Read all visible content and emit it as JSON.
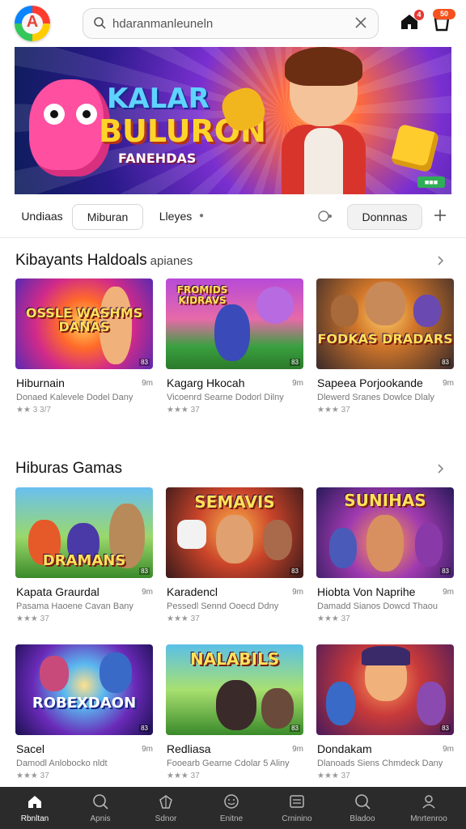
{
  "header": {
    "logo_letter": "A",
    "search_text": "hdaranmanleuneln",
    "cart_badge": "4",
    "notif_badge": "50"
  },
  "banner": {
    "title_line1": "KALAR",
    "title_line2": "BULURON",
    "title_line3": "FANEHDAS",
    "tag": "■■■"
  },
  "tabs": [
    "Undiaas",
    "Miburan",
    "Lleyes",
    "Donnnas"
  ],
  "sections": [
    {
      "title": "Kibayants Haldoals",
      "subtitle": "apianes",
      "cards": [
        {
          "name": "Hiburnain",
          "size": "9m",
          "desc": "Donaed Kalevele Dodel Dany",
          "rating": "★★ 3 3/7",
          "thumb_title": "OSSLE WASHMS DANAS",
          "tag": "83"
        },
        {
          "name": "Kagarg Hkocah",
          "size": "9m",
          "desc": "Vicoenrd Searne Dodorl Dilny",
          "rating": "★★★ 37",
          "thumb_title": "FROMIDS KIDRAVS",
          "tag": "83"
        },
        {
          "name": "Sapeea Porjookande",
          "size": "9m",
          "desc": "Dlewerd Sranes Dowlce Dlaly",
          "rating": "★★★ 37",
          "thumb_title": "FODKAS DRADARS",
          "tag": "83"
        }
      ]
    },
    {
      "title": "Hiburas Gamas",
      "subtitle": "",
      "cards": [
        {
          "name": "Kapata Graurdal",
          "size": "9m",
          "desc": "Pasama Haoene Cavan Bany",
          "rating": "★★★ 37",
          "thumb_title": "DRAMANS",
          "tag": "83"
        },
        {
          "name": "Karadencl",
          "size": "9m",
          "desc": "Pessedl Sennd Ooecd Ddny",
          "rating": "★★★ 37",
          "thumb_title": "SEMAVIS",
          "tag": "83"
        },
        {
          "name": "Hiobta Von Naprihe",
          "size": "9m",
          "desc": "Damadd Sianos Dowcd Thaou",
          "rating": "★★★ 37",
          "thumb_title": "SUNIHAS",
          "tag": "83"
        }
      ]
    },
    {
      "title": "",
      "subtitle": "",
      "cards": [
        {
          "name": "Sacel",
          "size": "9m",
          "desc": "Damodl Anlobocko nldt",
          "rating": "★★★ 37",
          "thumb_title": "ROBEXDAON",
          "tag": "83"
        },
        {
          "name": "Redliasa",
          "size": "9m",
          "desc": "Fooearb Gearne Cdolar 5 Aliny",
          "rating": "★★★ 37",
          "thumb_title": "NALABILS",
          "tag": "83"
        },
        {
          "name": "Dondakam",
          "size": "9m",
          "desc": "Dlanoads Siens Chmdeck Dany",
          "rating": "★★★ 37",
          "thumb_title": "",
          "tag": "83"
        }
      ]
    }
  ],
  "bottom_nav": [
    {
      "label": "Rbnltan",
      "icon": "home-icon"
    },
    {
      "label": "Apnis",
      "icon": "search-icon"
    },
    {
      "label": "Sdnor",
      "icon": "gift-icon"
    },
    {
      "label": "Enitne",
      "icon": "smile-icon"
    },
    {
      "label": "Crninino",
      "icon": "list-icon"
    },
    {
      "label": "Bladoo",
      "icon": "search-icon"
    },
    {
      "label": "Mnrtenroo",
      "icon": "user-icon"
    }
  ],
  "colors": {
    "accent_badge": "#f4511e",
    "nav_bg": "#2b2b2b"
  }
}
